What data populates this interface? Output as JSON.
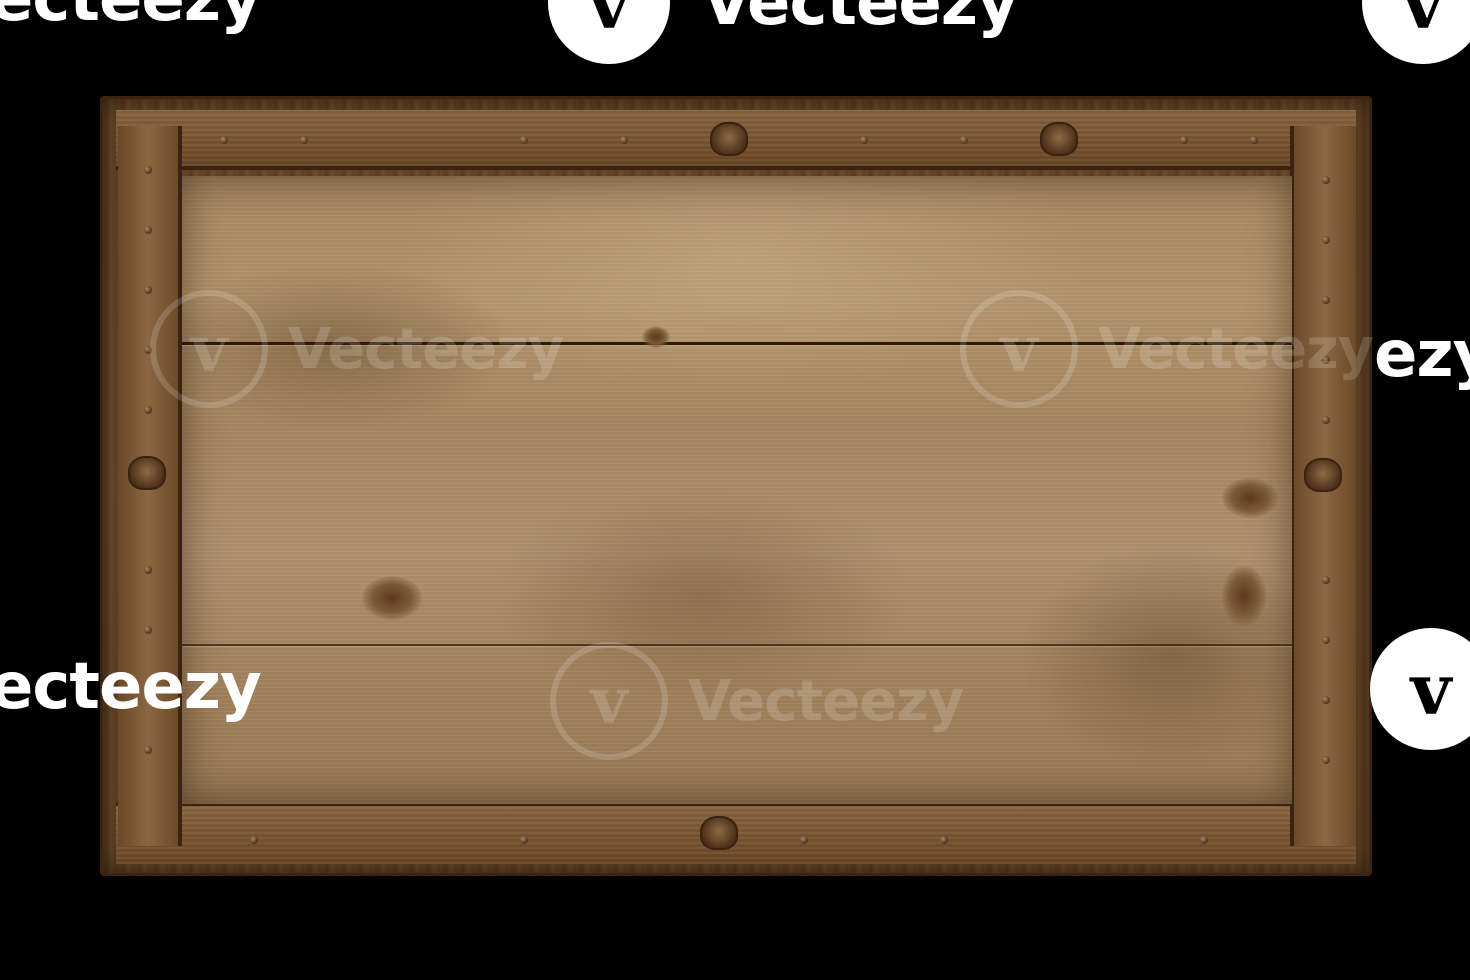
{
  "watermark": {
    "brand": "Vecteezy",
    "partial_left": "ecteezy",
    "partial_bottom_left": "ecteezy",
    "partial_right_mid": "ezy",
    "logo_glyph": "v",
    "logo_icon": "vecteezy-logo-icon"
  },
  "image": {
    "subject": "wooden-sign-board",
    "background_color": "#000000",
    "wood_light": "#b4966e",
    "wood_dark": "#6b4828",
    "frame_edge": "#3b2312"
  }
}
